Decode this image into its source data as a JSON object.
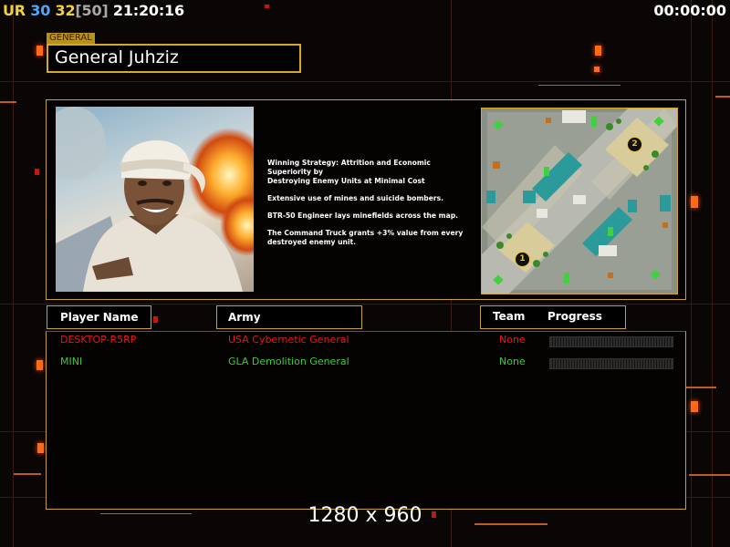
{
  "hud": {
    "ur_label": "UR",
    "stat_a": "30",
    "stat_b": "32",
    "stat_c": "[50]",
    "clock": "21:20:16",
    "timer": "00:00:00"
  },
  "header": {
    "tag": "GENERAL",
    "title": "General Juhziz"
  },
  "strategy": [
    "Winning Strategy: Attrition and Economic Superiority by\n Destroying Enemy Units at Minimal Cost",
    "Extensive use of mines and suicide bombers.",
    "BTR-50 Engineer lays minefields across the map.",
    "The Command Truck grants +3% value from every\n destroyed enemy unit."
  ],
  "minimap": {
    "start_positions": [
      "1",
      "2"
    ]
  },
  "columns": {
    "player_name": "Player Name",
    "army": "Army",
    "team": "Team",
    "progress": "Progress"
  },
  "players": [
    {
      "name": "DESKTOP-R5RP",
      "army": "USA Cybernetic General",
      "team": "None",
      "color": "#e8161a"
    },
    {
      "name": "MINI",
      "army": "GLA Demolition General",
      "team": "None",
      "color": "#3ec83e"
    }
  ],
  "footer": {
    "resolution": "1280 x 960"
  },
  "colors": {
    "accent_gold": "#c7a232",
    "background": "#0a0605"
  }
}
